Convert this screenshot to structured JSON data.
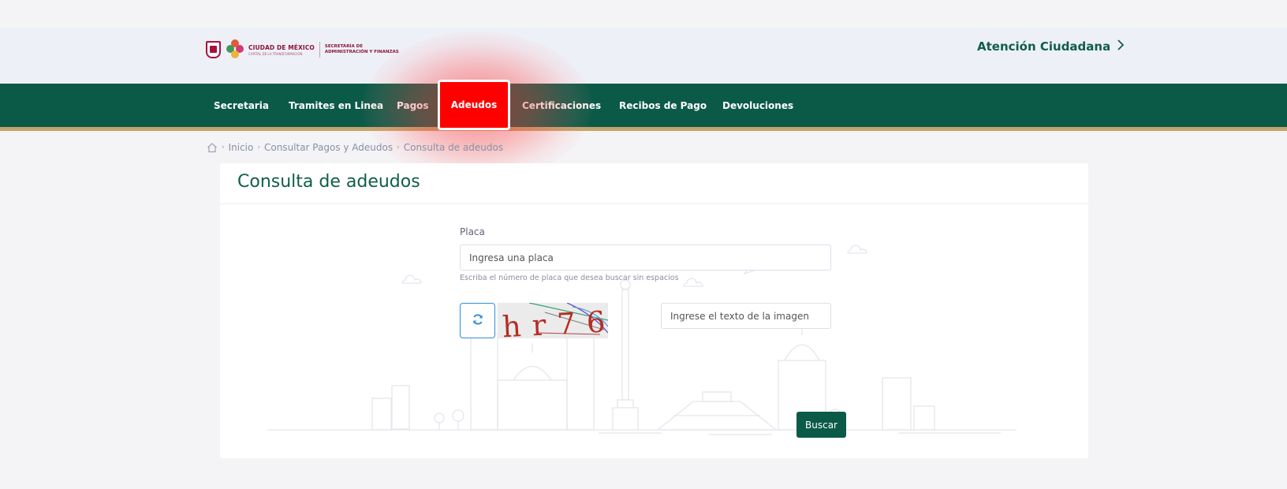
{
  "header": {
    "logo_city": "CIUDAD DE MÉXICO",
    "logo_city_sub": "CAPITAL DE LA TRANSFORMACIÓN",
    "logo_secretaria_l1": "SECRETARÍA DE",
    "logo_secretaria_l2": "ADMINISTRACIÓN Y FINANZAS",
    "atencion": "Atención Ciudadana",
    "atencion_icon": "chevron-right-icon"
  },
  "nav": {
    "items": [
      {
        "label": "Secretaria"
      },
      {
        "label": "Tramites en Linea"
      },
      {
        "label": "Pagos"
      },
      {
        "label": "Adeudos"
      },
      {
        "label": "Certificaciones"
      },
      {
        "label": "Recibos de Pago"
      },
      {
        "label": "Devoluciones"
      }
    ],
    "active": "Adeudos",
    "colors": {
      "bar": "#0b5a48",
      "gold": "#c4a46b",
      "highlight": "#ff0000"
    }
  },
  "breadcrumb": {
    "items": [
      "Inicio",
      "Consultar Pagos y Adeudos",
      "Consulta de adeudos"
    ],
    "home_icon": "home-icon"
  },
  "form": {
    "title": "Consulta de adeudos",
    "placa_label": "Placa",
    "placa_placeholder": "Ingresa una placa",
    "placa_help": "Escriba el número de placa que desea buscar sin espacios",
    "captcha_text": "hr76",
    "captcha_placeholder": "Ingrese el texto de la imagen",
    "refresh_icon": "refresh-icon",
    "submit_label": "Buscar"
  }
}
